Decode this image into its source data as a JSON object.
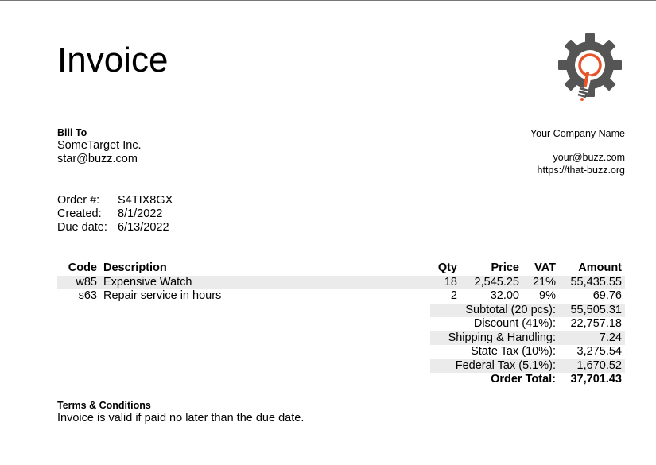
{
  "title": "Invoice",
  "logo": {
    "icon": "gear-lightbulb-logo",
    "accent": "#e8542a",
    "gear_color": "#555555"
  },
  "bill_to": {
    "label": "Bill To",
    "name": "SomeTarget Inc.",
    "email": "star@buzz.com"
  },
  "company": {
    "name": "Your Company Name",
    "email": "your@buzz.com",
    "website": "https://that-buzz.org"
  },
  "order": {
    "number_label": "Order #:",
    "number": "S4TIX8GX",
    "created_label": "Created:",
    "created": "8/1/2022",
    "due_label": "Due date:",
    "due": "6/13/2022"
  },
  "table": {
    "headers": {
      "code": "Code",
      "description": "Description",
      "qty": "Qty",
      "price": "Price",
      "vat": "VAT",
      "amount": "Amount"
    },
    "rows": [
      {
        "code": "w85",
        "description": "Expensive Watch",
        "qty": "18",
        "price": "2,545.25",
        "vat": "21%",
        "amount": "55,435.55"
      },
      {
        "code": "s63",
        "description": "Repair service in hours",
        "qty": "2",
        "price": "32.00",
        "vat": "9%",
        "amount": "69.76"
      }
    ],
    "totals": [
      {
        "label": "Subtotal (20 pcs):",
        "value": "55,505.31"
      },
      {
        "label": "Discount (41%):",
        "value": "22,757.18"
      },
      {
        "label": "Shipping & Handling:",
        "value": "7.24"
      },
      {
        "label": "State Tax (10%):",
        "value": "3,275.54"
      },
      {
        "label": "Federal Tax (5.1%):",
        "value": "1,670.52"
      }
    ],
    "order_total_label": "Order Total:",
    "order_total": "37,701.43"
  },
  "terms": {
    "label": "Terms & Conditions",
    "text": "Invoice is valid if paid no later than the due date."
  }
}
